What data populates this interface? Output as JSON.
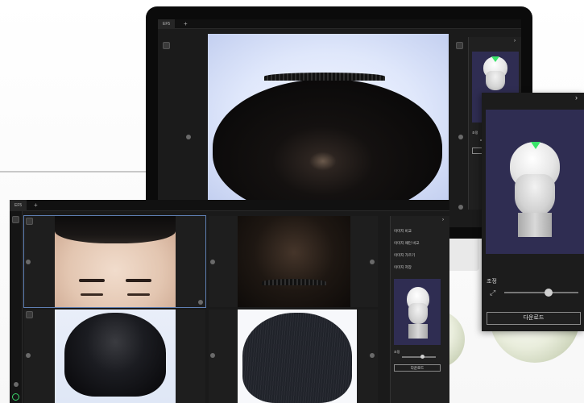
{
  "monitor_app": {
    "tab_label": "EF5",
    "tab_plus": "+",
    "panel_chevron": "›",
    "zoom_label": "조정"
  },
  "laptop_app": {
    "tab_label": "EF5",
    "tab_plus": "+",
    "panel_chevron": "›",
    "menu_items": [
      "이미지 비교",
      "이미지 패턴 비교",
      "이미지 가르기",
      "이미지 저장"
    ],
    "zoom_label": "조정",
    "download_label": "다운로드"
  },
  "popout_panel": {
    "chevron": "›",
    "zoom_label": "조정",
    "download_label": "다운로드",
    "slider_value": 0.6
  },
  "colors": {
    "accent_green": "#39e36a",
    "panel_bg": "#2f2d52",
    "selection_outline": "#5f7fb3"
  },
  "icons": [
    "camera-icon",
    "edit-icon",
    "chevron-right-icon",
    "expand-icon",
    "settings-icon",
    "power-icon"
  ]
}
